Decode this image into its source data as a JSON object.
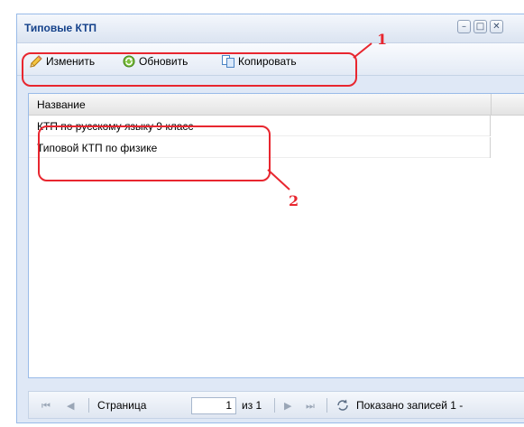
{
  "window": {
    "title": "Типовые КТП",
    "controls": {
      "minimize": "–",
      "maximize": "□",
      "close": "✕"
    }
  },
  "toolbar": {
    "edit_label": "Изменить",
    "refresh_label": "Обновить",
    "copy_label": "Копировать"
  },
  "grid": {
    "columns": [
      "Название"
    ],
    "rows": [
      {
        "name": "КТП по русскому языку 9 класс"
      },
      {
        "name": "Типовой КТП по физике"
      }
    ]
  },
  "paging": {
    "page_label": "Страница",
    "page_value": "1",
    "of_label": "из 1",
    "summary": "Показано записей 1 -"
  },
  "annotations": {
    "marker_1": "1",
    "marker_2": "2"
  },
  "colors": {
    "annotation": "#e8262f",
    "title_text": "#15428b",
    "panel_bg": "#dfe8f6",
    "border": "#99bbe8"
  }
}
